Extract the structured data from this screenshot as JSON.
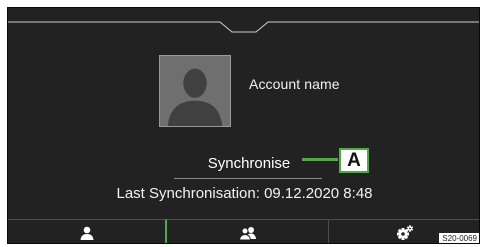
{
  "account": {
    "name": "Account name"
  },
  "sync": {
    "button_label": "Synchronise",
    "last_sync_text": "Last Synchronisation: 09.12.2020 8:48"
  },
  "callout": {
    "label": "A"
  },
  "tabs": [
    {
      "icon": "user-icon"
    },
    {
      "icon": "users-icon"
    },
    {
      "icon": "gear-icon"
    }
  ],
  "figure_label": "S20-0069",
  "colors": {
    "screen": "#222222",
    "accent_green": "#54a947",
    "avatar": "#6f6f6f"
  }
}
